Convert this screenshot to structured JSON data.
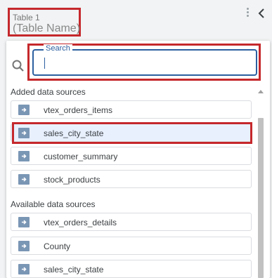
{
  "header": {
    "table_label": "Table 1",
    "table_name": "(Table Name)"
  },
  "search": {
    "label": "Search",
    "value": ""
  },
  "added_section": {
    "label": "Added data sources",
    "items": [
      {
        "label": "vtex_orders_items",
        "selected": false
      },
      {
        "label": "sales_city_state",
        "selected": true
      },
      {
        "label": "customer_summary",
        "selected": false
      },
      {
        "label": "stock_products",
        "selected": false
      }
    ]
  },
  "available_section": {
    "label": "Available data sources",
    "items": [
      {
        "label": "vtex_orders_details"
      },
      {
        "label": "County"
      },
      {
        "label": "sales_city_state"
      }
    ]
  },
  "icons": {
    "item": "data-source-arrow-icon",
    "search": "magnifier-icon",
    "menu": "kebab-menu-icon",
    "collapse": "chevron-left-icon"
  },
  "colors": {
    "highlight": "#c5282c",
    "accent": "#2c5fa0",
    "item_icon": "#7a96b5",
    "selected_bg": "#e8f0fe"
  }
}
